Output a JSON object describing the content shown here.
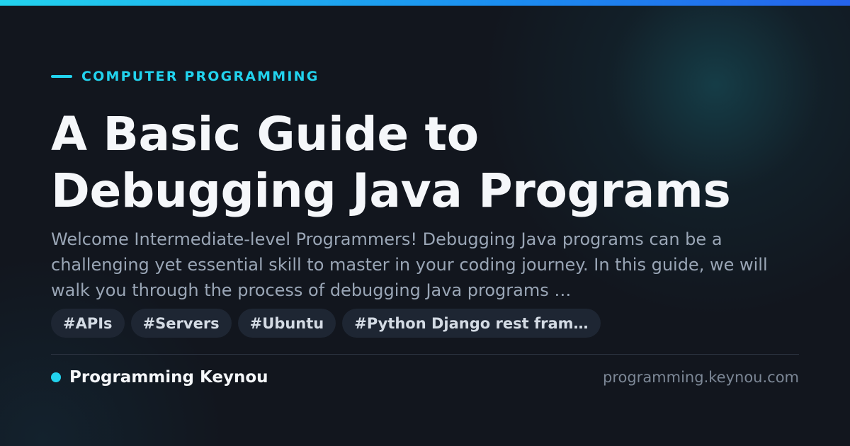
{
  "colors": {
    "accent": "#22d3ee",
    "background": "#12161e",
    "title": "#f5f7fa",
    "description": "#9aa6b6",
    "tag_background": "#1e2633"
  },
  "header": {
    "kicker": "COMPUTER PROGRAMMING"
  },
  "article": {
    "title_line1": "A Basic Guide to",
    "title_line2": "Debugging Java Programs",
    "description": "Welcome Intermediate-level Programmers! Debugging Java programs can be a challenging yet essential skill to master in your coding journey. In this guide, we will walk you through the process of debugging Java programs …"
  },
  "tags": [
    "#APIs",
    "#Servers",
    "#Ubuntu",
    "#Python Django rest fram…"
  ],
  "footer": {
    "site_name": "Programming Keynou",
    "domain": "programming.keynou.com"
  }
}
